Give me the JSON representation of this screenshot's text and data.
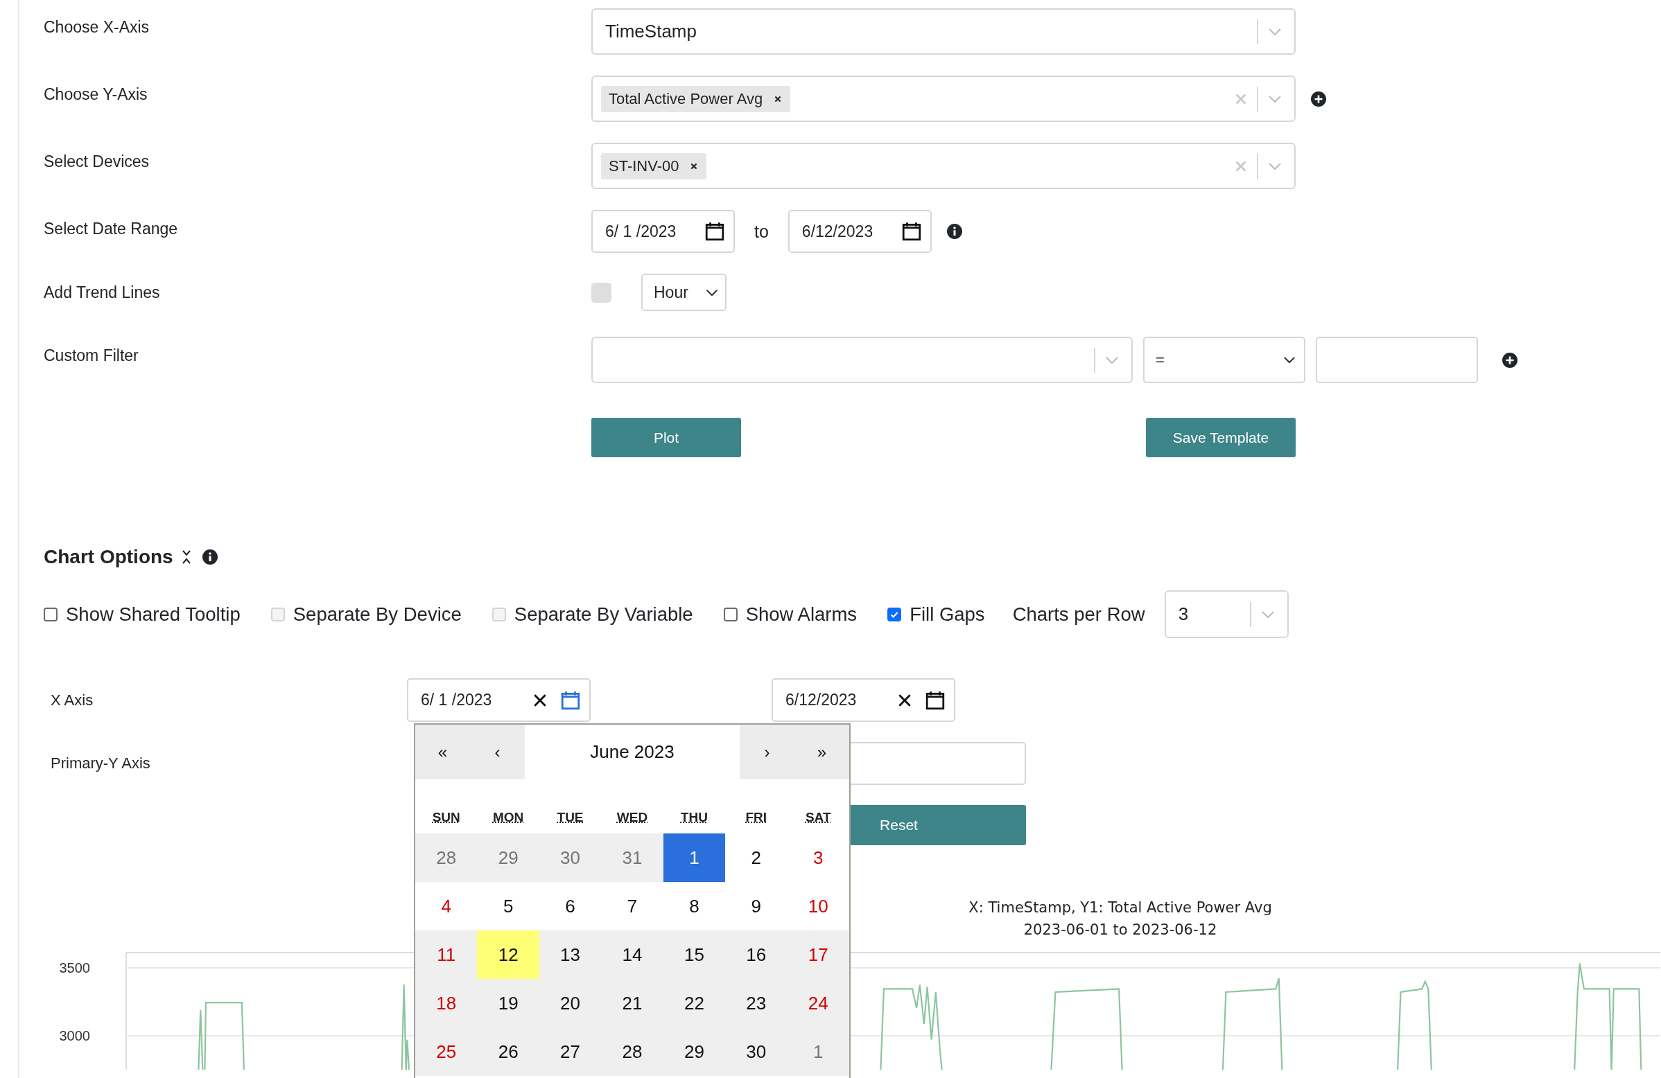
{
  "form": {
    "rows": [
      {
        "kind": "select",
        "label": "Choose X-Axis",
        "value": "TimeStamp",
        "add": false
      },
      {
        "kind": "multi",
        "label": "Choose Y-Axis",
        "tags": [
          "Total Active Power Avg"
        ],
        "add": true
      },
      {
        "kind": "multi",
        "label": "Select Devices",
        "tags": [
          "ST-INV-00"
        ],
        "add": false
      },
      {
        "kind": "date_range",
        "label": "Select Date Range",
        "start": "6/ 1 /2023",
        "separator": "to",
        "end": "6/12/2023"
      },
      {
        "kind": "trend",
        "label": "Add Trend Lines",
        "checked": false,
        "disabled": true,
        "interval": "Hour"
      },
      {
        "kind": "filter",
        "label": "Custom Filter",
        "operator": "=",
        "add": true
      }
    ],
    "buttons": [
      "Plot",
      "Save Template"
    ]
  },
  "chart_options": {
    "title": "Chart Options",
    "checkboxes": [
      {
        "label": "Show Shared Tooltip",
        "checked": false,
        "disabled": false
      },
      {
        "label": "Separate By Device",
        "checked": false,
        "disabled": true
      },
      {
        "label": "Separate By Variable",
        "checked": false,
        "disabled": true
      },
      {
        "label": "Show Alarms",
        "checked": false,
        "disabled": false
      },
      {
        "label": "Fill Gaps",
        "checked": true,
        "disabled": false
      }
    ],
    "charts_per_row": {
      "label": "Charts per Row",
      "value": "3"
    }
  },
  "axes": {
    "x_axis": {
      "label": "X Axis",
      "fields": [
        {
          "value": "6/ 1 /2023",
          "active": true
        },
        {
          "value": "6/12/2023",
          "active": false
        }
      ]
    },
    "primary_y": {
      "label": "Primary-Y Axis"
    },
    "reset_button": "Reset"
  },
  "calendar": {
    "prev_year": "«",
    "prev_month": "‹",
    "title": "June 2023",
    "next_month": "›",
    "next_year": "»",
    "weekdays": [
      "SUN",
      "MON",
      "TUE",
      "WED",
      "THU",
      "FRI",
      "SAT"
    ],
    "weeks": [
      [
        {
          "label": "28",
          "kind": "other_month",
          "selected": false,
          "today": false,
          "highlighted": true
        },
        {
          "label": "29",
          "kind": "other_month",
          "selected": false,
          "today": false,
          "highlighted": true
        },
        {
          "label": "30",
          "kind": "other_month",
          "selected": false,
          "today": false,
          "highlighted": true
        },
        {
          "label": "31",
          "kind": "other_month",
          "selected": false,
          "today": false,
          "highlighted": true
        },
        {
          "label": "1",
          "kind": "weekday",
          "selected": true,
          "today": false,
          "highlighted": false
        },
        {
          "label": "2",
          "kind": "weekday",
          "selected": false,
          "today": false,
          "highlighted": false
        },
        {
          "label": "3",
          "kind": "weekend",
          "selected": false,
          "today": false,
          "highlighted": false
        }
      ],
      [
        {
          "label": "4",
          "kind": "weekend",
          "selected": false,
          "today": false,
          "highlighted": false
        },
        {
          "label": "5",
          "kind": "weekday",
          "selected": false,
          "today": false,
          "highlighted": false
        },
        {
          "label": "6",
          "kind": "weekday",
          "selected": false,
          "today": false,
          "highlighted": false
        },
        {
          "label": "7",
          "kind": "weekday",
          "selected": false,
          "today": false,
          "highlighted": false
        },
        {
          "label": "8",
          "kind": "weekday",
          "selected": false,
          "today": false,
          "highlighted": false
        },
        {
          "label": "9",
          "kind": "weekday",
          "selected": false,
          "today": false,
          "highlighted": false
        },
        {
          "label": "10",
          "kind": "weekend",
          "selected": false,
          "today": false,
          "highlighted": false
        }
      ],
      [
        {
          "label": "11",
          "kind": "weekend",
          "selected": false,
          "today": false,
          "highlighted": true
        },
        {
          "label": "12",
          "kind": "weekday",
          "selected": false,
          "today": true,
          "highlighted": true
        },
        {
          "label": "13",
          "kind": "weekday",
          "selected": false,
          "today": false,
          "highlighted": true
        },
        {
          "label": "14",
          "kind": "weekday",
          "selected": false,
          "today": false,
          "highlighted": true
        },
        {
          "label": "15",
          "kind": "weekday",
          "selected": false,
          "today": false,
          "highlighted": true
        },
        {
          "label": "16",
          "kind": "weekday",
          "selected": false,
          "today": false,
          "highlighted": true
        },
        {
          "label": "17",
          "kind": "weekend",
          "selected": false,
          "today": false,
          "highlighted": true
        }
      ],
      [
        {
          "label": "18",
          "kind": "weekend",
          "selected": false,
          "today": false,
          "highlighted": true
        },
        {
          "label": "19",
          "kind": "weekday",
          "selected": false,
          "today": false,
          "highlighted": true
        },
        {
          "label": "20",
          "kind": "weekday",
          "selected": false,
          "today": false,
          "highlighted": true
        },
        {
          "label": "21",
          "kind": "weekday",
          "selected": false,
          "today": false,
          "highlighted": true
        },
        {
          "label": "22",
          "kind": "weekday",
          "selected": false,
          "today": false,
          "highlighted": true
        },
        {
          "label": "23",
          "kind": "weekday",
          "selected": false,
          "today": false,
          "highlighted": true
        },
        {
          "label": "24",
          "kind": "weekend",
          "selected": false,
          "today": false,
          "highlighted": true
        }
      ],
      [
        {
          "label": "25",
          "kind": "weekend",
          "selected": false,
          "today": false,
          "highlighted": true
        },
        {
          "label": "26",
          "kind": "weekday",
          "selected": false,
          "today": false,
          "highlighted": true
        },
        {
          "label": "27",
          "kind": "weekday",
          "selected": false,
          "today": false,
          "highlighted": true
        },
        {
          "label": "28",
          "kind": "weekday",
          "selected": false,
          "today": false,
          "highlighted": true
        },
        {
          "label": "29",
          "kind": "weekday",
          "selected": false,
          "today": false,
          "highlighted": true
        },
        {
          "label": "30",
          "kind": "weekday",
          "selected": false,
          "today": false,
          "highlighted": true
        },
        {
          "label": "1",
          "kind": "other_month",
          "selected": false,
          "today": false,
          "highlighted": true
        }
      ]
    ]
  },
  "chart": {
    "title": "X: TimeStamp, Y1: Total Active Power Avg",
    "subtitle": "2023-06-01 to 2023-06-12",
    "y_ticks": [
      "3500",
      "3000"
    ]
  }
}
